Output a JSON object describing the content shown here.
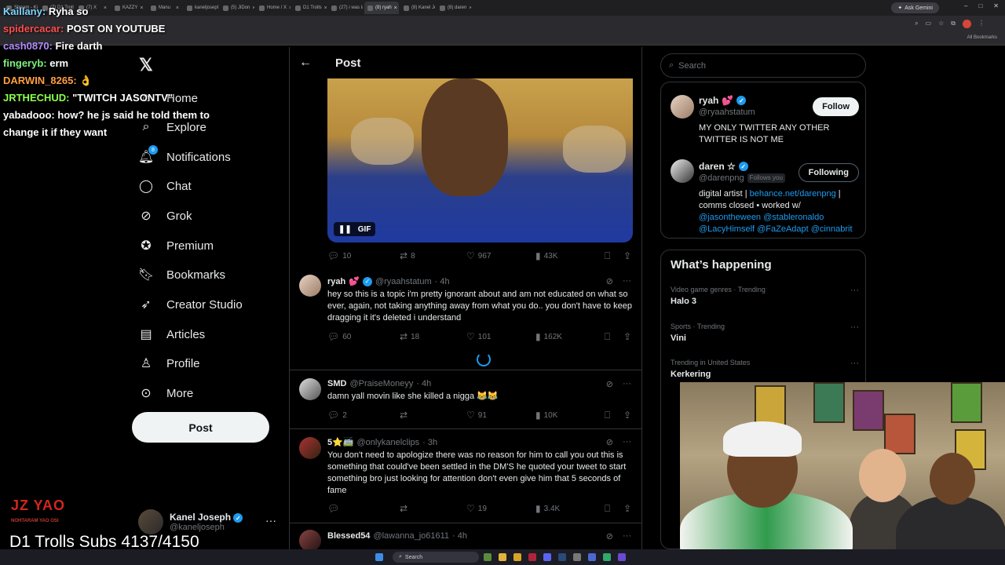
{
  "browser": {
    "tabs": [
      {
        "label": "Stream - Kick",
        "active": false
      },
      {
        "label": "(7) D1 Trolls",
        "active": false
      },
      {
        "label": "(7) X",
        "active": false
      },
      {
        "label": "KAZZY",
        "active": false
      },
      {
        "label": "Manu",
        "active": false
      },
      {
        "label": "kaneljoseph",
        "active": false
      },
      {
        "label": "(5) JiDon",
        "active": false
      },
      {
        "label": "Home / X",
        "active": false
      },
      {
        "label": "D1 Trolls",
        "active": false
      },
      {
        "label": "(27) i was laug",
        "active": false
      },
      {
        "label": "(8) ryah",
        "active": true
      },
      {
        "label": "(8) Kanel Jos",
        "active": false
      },
      {
        "label": "(8) daren",
        "active": false
      }
    ],
    "ask_gemini": "Ask Gemini",
    "all_bookmarks": "All Bookmarks"
  },
  "chat": [
    {
      "user": "Kaillany:",
      "msg": "Ryha so",
      "color": "#7fd3ff"
    },
    {
      "user": "spidercacar:",
      "msg": "POST ON YOUTUBE",
      "color": "#ff4d4d"
    },
    {
      "user": "cash0870:",
      "msg": "Fire darth",
      "color": "#b38cff"
    },
    {
      "user": "fingeryb:",
      "msg": "erm",
      "color": "#7ef27e"
    },
    {
      "user": "DARWIN_8265:",
      "msg": "👌",
      "color": "#ff9f40"
    },
    {
      "user": "JRTHECHUD:",
      "msg": "\"TWITCH JASONTV\"",
      "color": "#8cff4d"
    },
    {
      "user": "yabadooo:",
      "msg": "how? he js said he told them to",
      "color": "#ffffff"
    },
    {
      "user": "",
      "msg": "change it if they want",
      "color": "#ffffff"
    }
  ],
  "overlay": {
    "subs_text": "D1 Trolls Subs 4137/4150",
    "logo_text": "JZ YAO",
    "logo_sub": "NOHTARAM YAO OSI"
  },
  "nav": {
    "home": "Home",
    "explore": "Explore",
    "notifications": "Notifications",
    "notifications_badge": "8",
    "chat": "Chat",
    "grok": "Grok",
    "premium": "Premium",
    "bookmarks": "Bookmarks",
    "creator_studio": "Creator Studio",
    "articles": "Articles",
    "profile": "Profile",
    "more": "More",
    "post_button": "Post"
  },
  "account": {
    "name": "Kanel Joseph",
    "handle": "@kaneljoseph"
  },
  "main": {
    "title": "Post",
    "gif_label": "GIF",
    "media_stats": {
      "replies": "10",
      "reposts": "8",
      "likes": "967",
      "views": "43K"
    },
    "replies": [
      {
        "name": "ryah",
        "emoji": "💕",
        "verified": true,
        "handle": "@ryaahstatum",
        "time": "· 4h",
        "text": "hey so this is a topic i'm pretty ignorant about and am not educated on what so ever, again, not taking anything away from what you do.. you don't have to keep dragging it it's deleted i understand",
        "stats": {
          "replies": "60",
          "reposts": "18",
          "likes": "101",
          "views": "162K"
        }
      },
      {
        "name": "SMD",
        "emoji": "",
        "verified": false,
        "handle": "@PraiseMoneyy",
        "time": "· 4h",
        "text": "damn yall movin like she killed a nigga 😹😹",
        "stats": {
          "replies": "2",
          "reposts": "",
          "likes": "91",
          "views": "10K"
        }
      },
      {
        "name": "5⭐🚎",
        "emoji": "",
        "verified": false,
        "handle": "@onlykanelclips",
        "time": "· 3h",
        "text": "You don't need to apologize there was no reason for him to call you out this is something that could've been settled in the DM'S he quoted your tweet to start something bro just looking for attention don't even give him that 5 seconds of fame",
        "stats": {
          "replies": "",
          "reposts": "",
          "likes": "19",
          "views": "3.4K"
        }
      },
      {
        "name": "Blessed54",
        "emoji": "",
        "verified": false,
        "handle": "@lawanna_jo61611",
        "time": "· 4h",
        "text": "",
        "stats": {
          "replies": "",
          "reposts": "",
          "likes": "",
          "views": ""
        }
      }
    ]
  },
  "right": {
    "search_placeholder": "Search",
    "who": [
      {
        "name": "ryah",
        "emoji": "💕",
        "handle": "@ryaahstatum",
        "follows_you": "",
        "button": "Follow",
        "bio": "MY ONLY TWITTER ANY OTHER TWITTER IS NOT ME"
      },
      {
        "name": "daren ☆",
        "emoji": "",
        "handle": "@darenpng",
        "follows_you": "Follows you",
        "button": "Following",
        "bio_prefix": "digital artist | ",
        "bio_link1": "behance.net/darenpng",
        "bio_mid": " | comms closed • worked w/",
        "bio_link2": "@jasontheween @stableronaldo @LacyHimself @FaZeAdapt @cinnabrit"
      }
    ],
    "whats_happening_title": "What’s happening",
    "trends": [
      {
        "meta": "Video game genres · Trending",
        "name": "Halo 3"
      },
      {
        "meta": "Sports · Trending",
        "name": "Vini"
      },
      {
        "meta": "Trending in United States",
        "name": "Kerkering"
      }
    ]
  },
  "taskbar": {
    "search_label": "Search"
  }
}
